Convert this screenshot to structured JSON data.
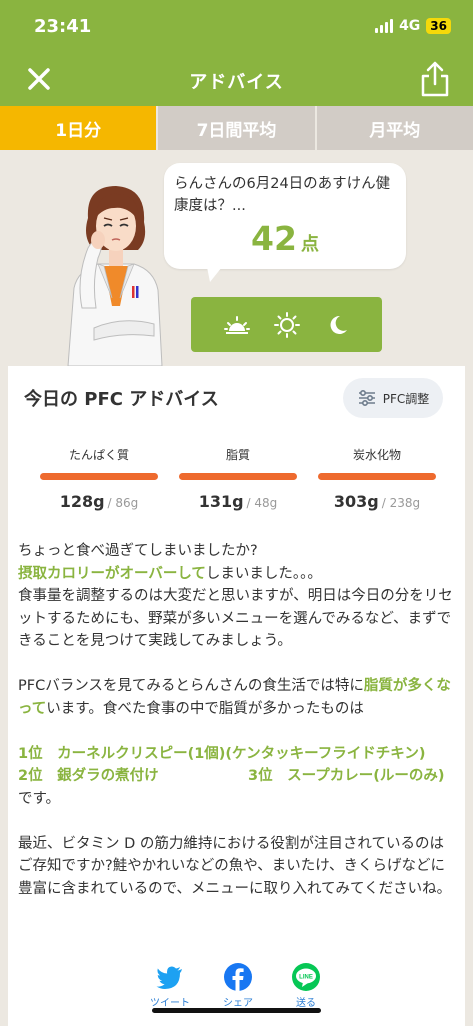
{
  "status": {
    "time": "23:41",
    "network": "4G",
    "battery": "36"
  },
  "header": {
    "title": "アドバイス",
    "close_icon": "close-icon",
    "share_icon": "share-icon"
  },
  "tabs": [
    {
      "label": "1日分",
      "active": true
    },
    {
      "label": "7日間平均",
      "active": false
    },
    {
      "label": "月平均",
      "active": false
    }
  ],
  "hero": {
    "bubble_text": "らんさんの6月24日のあすけん健康度は？...",
    "score": "42",
    "score_unit": "点",
    "time_icons": [
      "sunrise-icon",
      "sun-icon",
      "moon-icon"
    ]
  },
  "pfc": {
    "title": "今日の PFC アドバイス",
    "settings_label": "PFC調整",
    "items": [
      {
        "name": "たんぱく質",
        "value": "128g",
        "target": "/ 86g"
      },
      {
        "name": "脂質",
        "value": "131g",
        "target": "/ 48g"
      },
      {
        "name": "炭水化物",
        "value": "303g",
        "target": "/ 238g"
      }
    ]
  },
  "advice": {
    "p1_line1": "ちょっと食べ過ぎてしまいましたか?",
    "p1_hl": "摂取カロリーがオーバーして",
    "p1_line2_rest": "しまいました。。。",
    "p1_line3": "食事量を調整するのは大変だと思いますが、明日は今日の分をリセットするためにも、野菜が多いメニューを選んでみるなど、まずできることを見つけて実践してみましょう。",
    "p2_pre": "PFCバランスを見てみるとらんさんの食生活では特に",
    "p2_hl": "脂質が多くなって",
    "p2_post": "います。食べた食事の中で脂質が多かったものは",
    "rank1": "1位　カーネルクリスピー(1個)(ケンタッキーフライドチキン)",
    "rank2": "2位　銀ダラの煮付け",
    "rank3": "3位　スープカレー(ルーのみ)",
    "rank_suffix": "です。",
    "p3": "最近、ビタミン D の筋力維持における役割が注目されているのはご存知ですか?鮭やかれいなどの魚や、まいたけ、きくらげなどに豊富に含まれているので、メニューに取り入れてみてくださいね。"
  },
  "share": [
    {
      "label": "ツイート",
      "icon": "twitter-icon"
    },
    {
      "label": "シェア",
      "icon": "facebook-icon"
    },
    {
      "label": "送る",
      "icon": "line-icon"
    }
  ],
  "colors": {
    "brand_green": "#8ab440",
    "active_tab": "#f5b700",
    "bar_orange": "#ee6a2e"
  }
}
